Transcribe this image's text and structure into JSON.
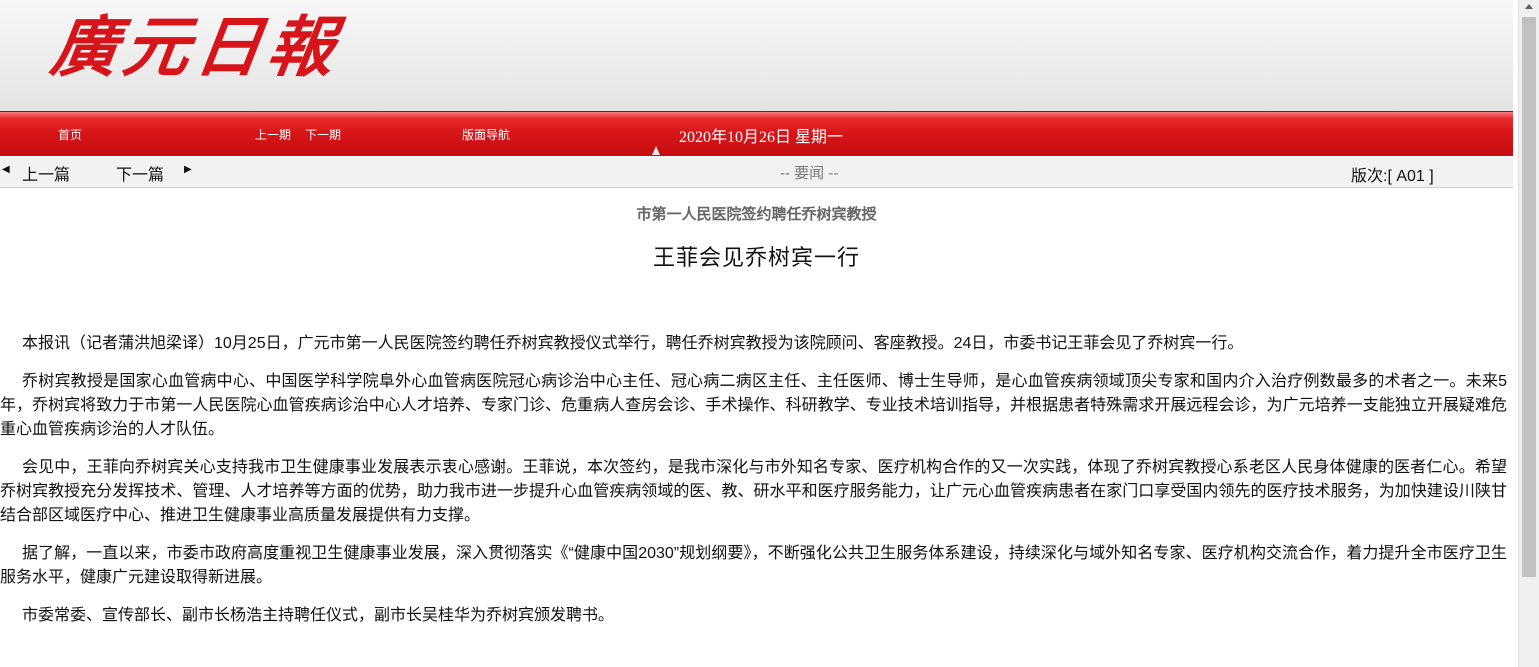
{
  "brand": {
    "logo_text": "廣元日報"
  },
  "nav": {
    "home": "首页",
    "prev_issue": "上一期",
    "next_issue": "下一期",
    "page_nav": "版面导航",
    "date": "2020年10月26日 星期一"
  },
  "subnav": {
    "prev_article": "上一篇",
    "next_article": "下一篇",
    "section": "-- 要闻 --",
    "edition": "版次:[ A01 ]"
  },
  "article": {
    "subtitle": "市第一人民医院签约聘任乔树宾教授",
    "title": "王菲会见乔树宾一行",
    "paragraphs": [
      "本报讯（记者蒲洪旭梁译）10月25日，广元市第一人民医院签约聘任乔树宾教授仪式举行，聘任乔树宾教授为该院顾问、客座教授。24日，市委书记王菲会见了乔树宾一行。",
      "乔树宾教授是国家心血管病中心、中国医学科学院阜外心血管病医院冠心病诊治中心主任、冠心病二病区主任、主任医师、博士生导师，是心血管疾病领域顶尖专家和国内介入治疗例数最多的术者之一。未来5年，乔树宾将致力于市第一人民医院心血管疾病诊治中心人才培养、专家门诊、危重病人查房会诊、手术操作、科研教学、专业技术培训指导，并根据患者特殊需求开展远程会诊，为广元培养一支能独立开展疑难危重心血管疾病诊治的人才队伍。",
      "会见中，王菲向乔树宾关心支持我市卫生健康事业发展表示衷心感谢。王菲说，本次签约，是我市深化与市外知名专家、医疗机构合作的又一次实践，体现了乔树宾教授心系老区人民身体健康的医者仁心。希望乔树宾教授充分发挥技术、管理、人才培养等方面的优势，助力我市进一步提升心血管疾病领域的医、教、研水平和医疗服务能力，让广元心血管疾病患者在家门口享受国内领先的医疗技术服务，为加快建设川陕甘结合部区域医疗中心、推进卫生健康事业高质量发展提供有力支撑。",
      "据了解，一直以来，市委市政府高度重视卫生健康事业发展，深入贯彻落实《“健康中国2030”规划纲要》，不断强化公共卫生服务体系建设，持续深化与域外知名专家、医疗机构交流合作，着力提升全市医疗卫生服务水平，健康广元建设取得新进展。",
      "市委常委、宣传部长、副市长杨浩主持聘任仪式，副市长吴桂华为乔树宾颁发聘书。"
    ]
  },
  "colors": {
    "brand_red": "#d8141b",
    "nav_red": "#d9161a"
  }
}
